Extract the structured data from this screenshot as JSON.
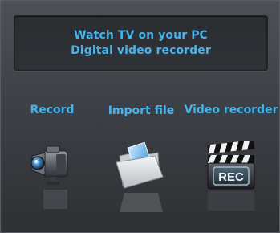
{
  "banner": {
    "line1": "Watch TV on your PC",
    "line2": "Digital video recorder"
  },
  "actions": [
    {
      "label": "Record",
      "icon": "camcorder-icon"
    },
    {
      "label": "Import file",
      "icon": "folder-icon"
    },
    {
      "label": "Video recorder",
      "icon": "clapperboard-rec-icon"
    }
  ],
  "rec_text": "REC",
  "colors": {
    "accent": "#46b3ec",
    "background": "#3d4045",
    "panel": "#2c2f33"
  }
}
